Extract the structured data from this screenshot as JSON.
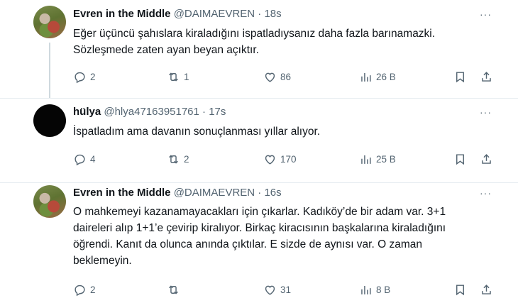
{
  "tweets": [
    {
      "name": "Evren in the Middle",
      "handle": "@DAIMAEVREN",
      "separator": "·",
      "time": "18s",
      "text_lines": [
        "Eğer üçüncü şahıslara kiraladığını ispatladıysanız daha fazla barınamazki.",
        "Sözleşmede zaten ayan beyan açıktır."
      ],
      "replies": "2",
      "reposts": "1",
      "likes": "86",
      "views": "26 B",
      "more": "···"
    },
    {
      "name": "hülya",
      "handle": "@hlya47163951761",
      "separator": "·",
      "time": "17s",
      "text_lines": [
        "İspatladım ama davanın sonuçlanması yıllar alıyor."
      ],
      "replies": "4",
      "reposts": "2",
      "likes": "170",
      "views": "25 B",
      "more": "···"
    },
    {
      "name": "Evren in the Middle",
      "handle": "@DAIMAEVREN",
      "separator": "·",
      "time": "16s",
      "text_lines": [
        "O mahkemeyi kazanamayacakları için çıkarlar. Kadıköy’de bir adam var. 3+1",
        "daireleri alıp 1+1’e çevirip kiralıyor. Birkaç kiracısının başkalarına kiraladığını",
        "öğrendi. Kanıt da olunca anında çıktılar. E sizde de aynısı var. O zaman",
        "beklemeyin."
      ],
      "replies": "2",
      "reposts": "",
      "likes": "31",
      "views": "8 B",
      "more": "···"
    }
  ],
  "icons": {
    "reply": "reply-icon",
    "repost": "repost-icon",
    "like": "heart-icon",
    "views": "views-icon",
    "bookmark": "bookmark-icon",
    "share": "share-icon"
  },
  "colors": {
    "text": "#0f1419",
    "muted": "#536471",
    "thread_line": "#cfd9de"
  }
}
